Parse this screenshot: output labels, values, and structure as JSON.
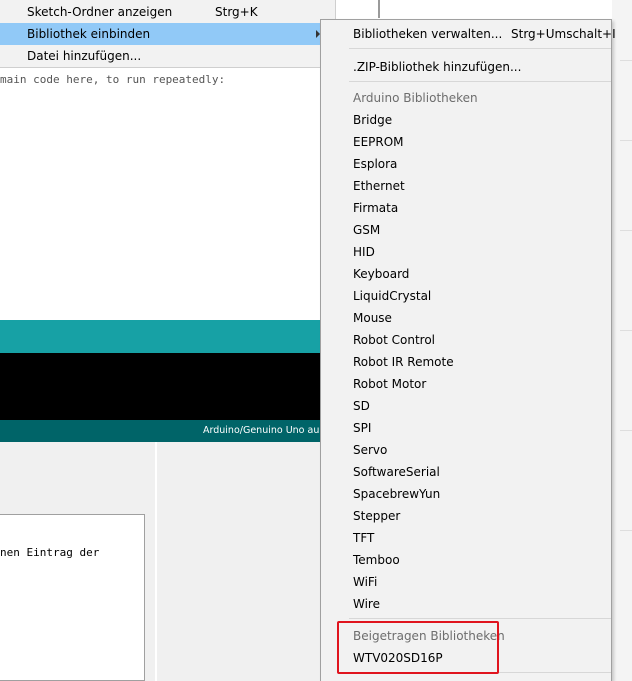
{
  "editor": {
    "code_line": "main code here, to run repeatedly:"
  },
  "status_bar": {
    "board_text": "Arduino/Genuino Uno au"
  },
  "lower_panel": {
    "text": "nen Eintrag der"
  },
  "sketch_menu": {
    "items": [
      {
        "label": "Sketch-Ordner anzeigen",
        "shortcut": "Strg+K"
      },
      {
        "label": "Bibliothek einbinden",
        "shortcut": ""
      },
      {
        "label": "Datei hinzufügen...",
        "shortcut": ""
      }
    ]
  },
  "library_menu": {
    "manage": {
      "label": "Bibliotheken verwalten...",
      "shortcut": "Strg+Umschalt+I"
    },
    "add_zip": {
      "label": ".ZIP-Bibliothek hinzufügen..."
    },
    "arduino_header": "Arduino Bibliotheken",
    "arduino_libraries": [
      "Bridge",
      "EEPROM",
      "Esplora",
      "Ethernet",
      "Firmata",
      "GSM",
      "HID",
      "Keyboard",
      "LiquidCrystal",
      "Mouse",
      "Robot Control",
      "Robot IR Remote",
      "Robot Motor",
      "SD",
      "SPI",
      "Servo",
      "SoftwareSerial",
      "SpacebrewYun",
      "Stepper",
      "TFT",
      "Temboo",
      "WiFi",
      "Wire"
    ],
    "contributed_header": "Beigetragen Bibliotheken",
    "contributed_libraries": [
      "WTV020SD16P"
    ]
  },
  "colors": {
    "menu_highlight": "#91c9f7",
    "ide_teal": "#17a1a5",
    "ide_dark_teal": "#006468",
    "annotation_red": "#e0141e"
  }
}
